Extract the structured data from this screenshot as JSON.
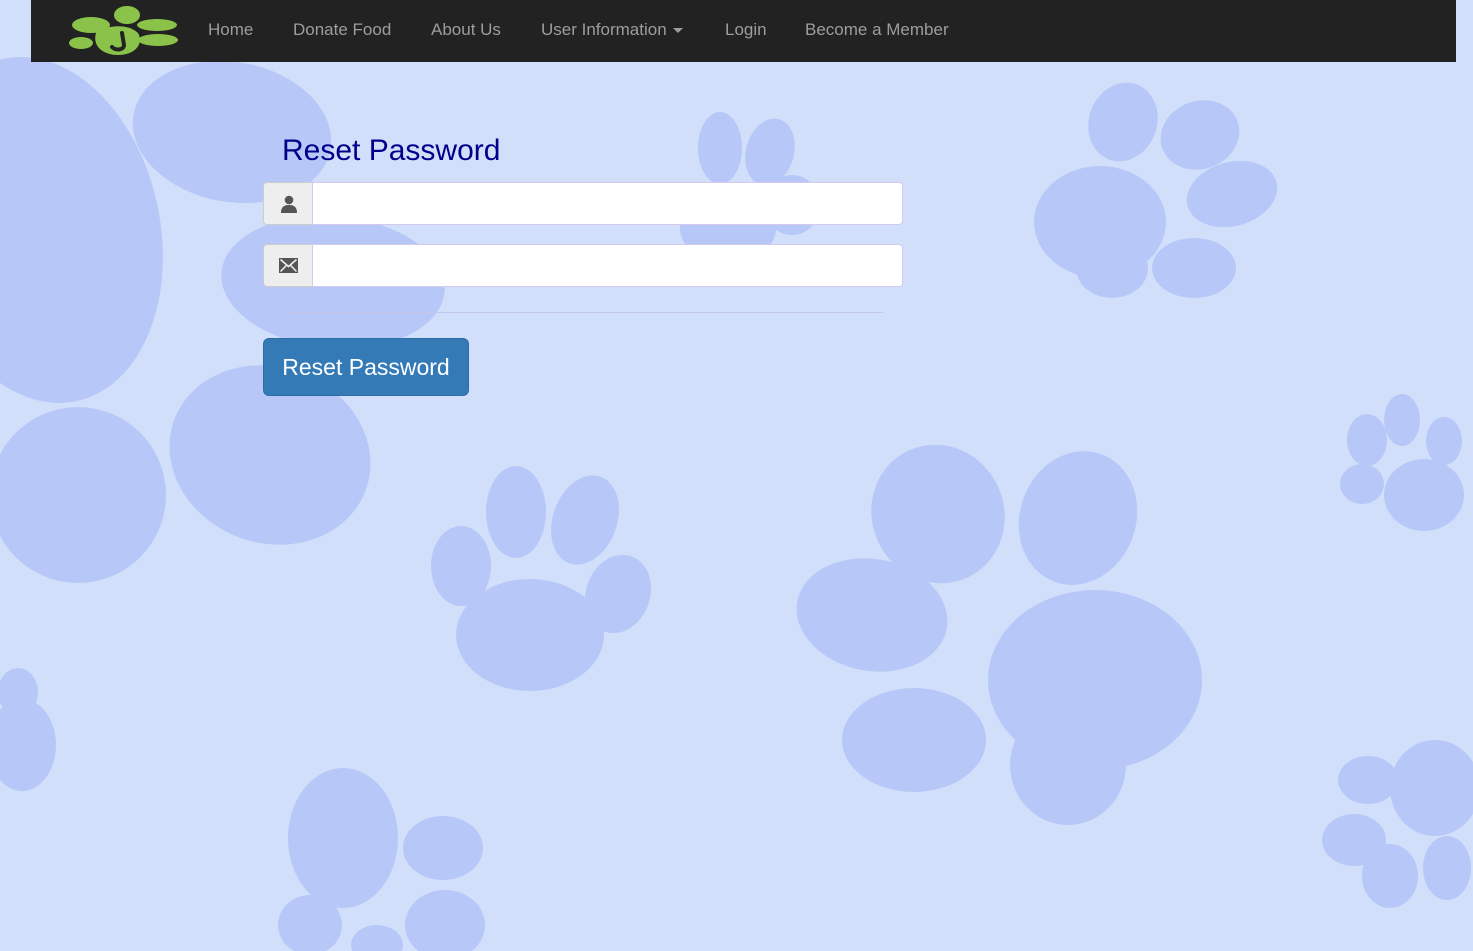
{
  "colors": {
    "page_background": "#d2dffa",
    "paw_print": "#b7c8f8",
    "navbar_background": "#222222",
    "nav_text": "#9d9d9d",
    "logo_green": "#8bc34a",
    "title_text": "#00008b",
    "button_primary": "#337ab7",
    "button_text": "#ffffff"
  },
  "navbar": {
    "logo_icon": "paw-print-logo",
    "items": [
      {
        "label": "Home"
      },
      {
        "label": "Donate Food"
      },
      {
        "label": "About Us"
      },
      {
        "label": "User Information",
        "has_dropdown": true
      },
      {
        "label": "Login"
      },
      {
        "label": "Become a Member"
      }
    ]
  },
  "form": {
    "title": "Reset Password",
    "username_field": {
      "icon": "user-icon",
      "value": "",
      "placeholder": ""
    },
    "email_field": {
      "icon": "envelope-icon",
      "value": "",
      "placeholder": ""
    },
    "submit_label": "Reset Password"
  }
}
